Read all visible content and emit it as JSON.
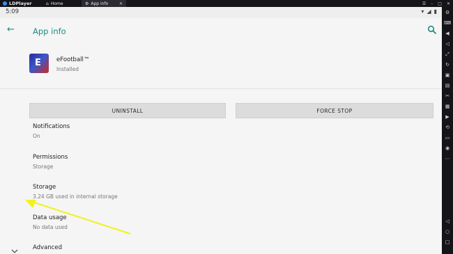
{
  "emulator": {
    "brand": "LDPlayer",
    "tabs": [
      {
        "label": "Home"
      },
      {
        "label": "App info"
      }
    ]
  },
  "status_bar": {
    "time": "5:09"
  },
  "app_bar": {
    "title": "App info"
  },
  "app": {
    "name": "eFootball™",
    "state": "Installed"
  },
  "buttons": {
    "uninstall": "UNINSTALL",
    "force_stop": "FORCE STOP"
  },
  "settings": [
    {
      "title": "Notifications",
      "subtitle": "On"
    },
    {
      "title": "Permissions",
      "subtitle": "Storage"
    },
    {
      "title": "Storage",
      "subtitle": "3.24 GB used in internal storage"
    },
    {
      "title": "Data usage",
      "subtitle": "No data used"
    },
    {
      "title": "Advanced",
      "subtitle": ""
    }
  ],
  "colors": {
    "accent": "#1b8a7d",
    "annotation_arrow": "#f2f21f"
  }
}
